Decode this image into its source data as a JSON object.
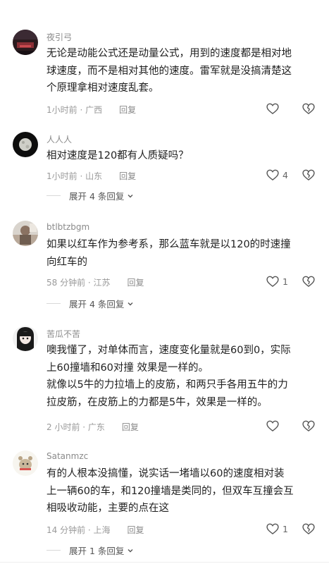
{
  "comments": [
    {
      "username": "夜引弓",
      "lines": [
        "无论是动能公式还是动量公式，用到的速度都是相对地",
        "球速度，而不是相对其他的速度。雷军就是没搞清楚这",
        "个原理拿相对速度乱套。"
      ],
      "time_location": "1小时前 · 广西",
      "reply_label": "回复",
      "like_count": ""
    },
    {
      "username": "人人人",
      "lines": [
        "相对速度是120都有人质疑吗？"
      ],
      "time_location": "1小时前 · 山东",
      "reply_label": "回复",
      "like_count": "4",
      "expand_label": "展开 4 条回复"
    },
    {
      "username": "btlbtzbgm",
      "lines": [
        "如果以红车作为参考系，那么蓝车就是以120的时速撞",
        "向红车的"
      ],
      "time_location": "58 分钟前 · 江苏",
      "reply_label": "回复",
      "like_count": "1",
      "expand_label": "展开 4 条回复"
    },
    {
      "username": "苦瓜不苦",
      "lines": [
        "噢我懂了，对单体而言，速度变化量就是60到0，实际",
        "上60撞墙和60对撞 效果是一样的。",
        "就像以5牛的力拉墙上的皮筋，和两只手各用五牛的力",
        "拉皮筋，在皮筋上的力都是5牛，效果是一样的。"
      ],
      "time_location": "2 小时前 · 广东",
      "reply_label": "回复",
      "like_count": ""
    },
    {
      "username": "Satanmzc",
      "lines": [
        "有的人根本没搞懂，说实话一堵墙以60的速度相对装",
        "上一辆60的车，和120撞墙是类同的，但双车互撞会互",
        "相吸收动能，主要的点在这"
      ],
      "time_location": "14 分钟前 · 上海",
      "reply_label": "回复",
      "like_count": "1",
      "expand_label": "展开 1 条回复"
    }
  ],
  "icons": {
    "like": "heart-outline-icon",
    "dislike": "broken-heart-icon",
    "expand": "chevron-down-icon"
  },
  "colors": {
    "text": "#1f1f1f",
    "meta": "#9a9a9a",
    "icon": "#555555"
  }
}
